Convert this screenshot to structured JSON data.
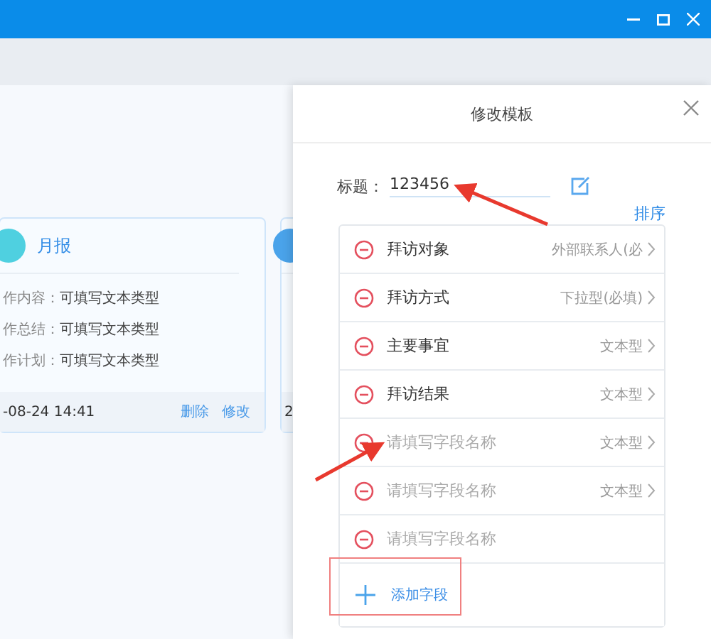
{
  "cards": [
    {
      "title": "月报",
      "rows": [
        {
          "label": "作内容：",
          "value": "可填写文本类型"
        },
        {
          "label": "作总结：",
          "value": "可填写文本类型"
        },
        {
          "label": "作计划：",
          "value": "可填写文本类型"
        }
      ],
      "time": "-08-24 14:41",
      "actions": [
        "删除",
        "修改"
      ]
    },
    {
      "time": "2"
    }
  ],
  "panel": {
    "title": "修改模板",
    "title_label": "标题：",
    "title_value": "123456",
    "sort_link": "排序",
    "fields": [
      {
        "name": "拜访对象",
        "placeholder": false,
        "type": "外部联系人(必"
      },
      {
        "name": "拜访方式",
        "placeholder": false,
        "type": "下拉型(必填)"
      },
      {
        "name": "主要事宜",
        "placeholder": false,
        "type": "文本型"
      },
      {
        "name": "拜访结果",
        "placeholder": false,
        "type": "文本型"
      },
      {
        "name": "请填写字段名称",
        "placeholder": true,
        "type": "文本型"
      },
      {
        "name": "请填写字段名称",
        "placeholder": true,
        "type": "文本型"
      },
      {
        "name": "请填写字段名称",
        "placeholder": true
      }
    ],
    "add_field": "添加字段"
  }
}
